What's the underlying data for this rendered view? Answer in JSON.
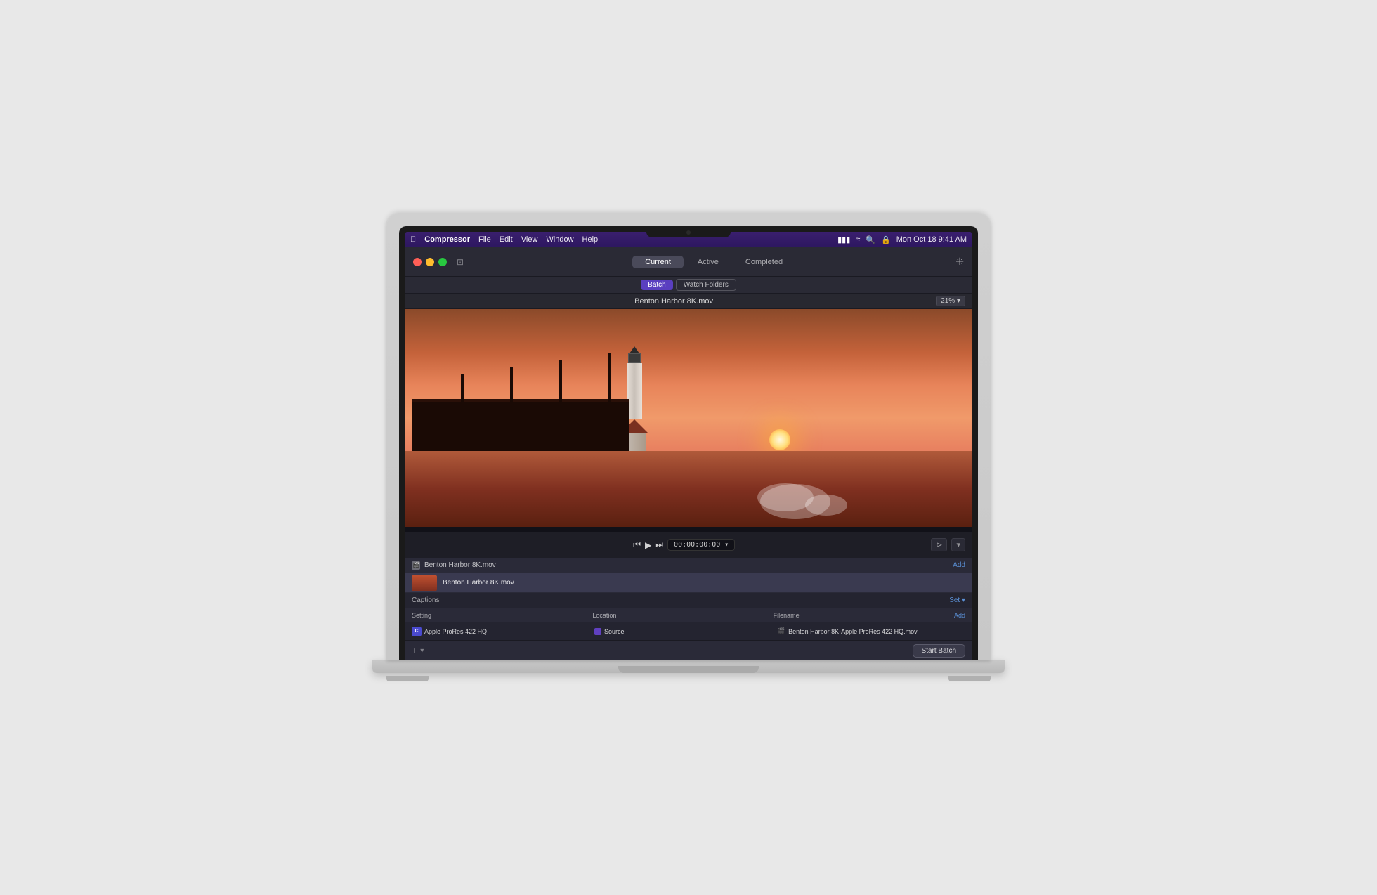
{
  "menubar": {
    "app_name": "Compressor",
    "menu_items": [
      "File",
      "Edit",
      "View",
      "Window",
      "Help"
    ],
    "time": "Mon Oct 18  9:41 AM"
  },
  "toolbar": {
    "tabs": [
      {
        "label": "Current",
        "active": true
      },
      {
        "label": "Active",
        "active": false
      },
      {
        "label": "Completed",
        "active": false
      }
    ]
  },
  "subtitle_bar": {
    "batch_label": "Batch",
    "watch_folders_label": "Watch Folders"
  },
  "filename_bar": {
    "filename": "Benton Harbor 8K.mov",
    "zoom": "21%"
  },
  "transport": {
    "timecode": "00:00:00:00"
  },
  "batch_header": {
    "filename": "Benton Harbor 8K.mov",
    "add_label": "Add"
  },
  "batch_item": {
    "filename": "Benton Harbor 8K.mov"
  },
  "captions": {
    "label": "Captions",
    "set_label": "Set ▾"
  },
  "settings_cols": {
    "setting_label": "Setting",
    "location_label": "Location",
    "filename_label": "Filename",
    "add_label": "Add"
  },
  "settings_row": {
    "setting_icon_letter": "C",
    "setting_value": "Apple ProRes 422 HQ",
    "location_value": "Source",
    "filename_value": "Benton Harbor 8K-Apple ProRes 422 HQ.mov"
  },
  "bottom_bar": {
    "start_batch_label": "Start Batch"
  }
}
